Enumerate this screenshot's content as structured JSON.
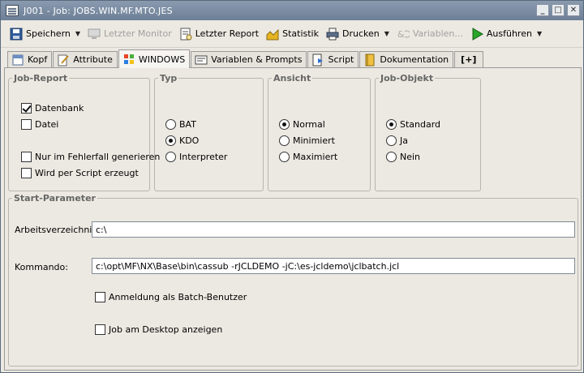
{
  "window": {
    "title": "J001 - Job: JOBS.WIN.MF.MTO.JES",
    "min_glyph": "_",
    "max_glyph": "□",
    "close_glyph": "✕"
  },
  "toolbar": {
    "save": "Speichern",
    "monitor": "Letzter Monitor",
    "report": "Letzter Report",
    "stats": "Statistik",
    "print": "Drucken",
    "variables": "Variablen...",
    "run": "Ausführen",
    "dropdown_glyph": "▼"
  },
  "tabs": [
    {
      "label": "Kopf",
      "icon": "head-icon"
    },
    {
      "label": "Attribute",
      "icon": "pen-icon"
    },
    {
      "label": "WINDOWS",
      "icon": "windows-icon"
    },
    {
      "label": "Variablen & Prompts",
      "icon": "vars-icon"
    },
    {
      "label": "Script",
      "icon": "script-icon"
    },
    {
      "label": "Dokumentation",
      "icon": "book-icon"
    },
    {
      "label": "[+]",
      "icon": "plus-icon"
    }
  ],
  "active_tab": "WINDOWS",
  "job_report": {
    "legend": "Job-Report",
    "database": {
      "label": "Datenbank",
      "checked": true
    },
    "file": {
      "label": "Datei",
      "checked": false
    },
    "only_error": {
      "label": "Nur im Fehlerfall generieren",
      "checked": false
    },
    "by_script": {
      "label": "Wird per Script erzeugt",
      "checked": false
    }
  },
  "type": {
    "legend": "Typ",
    "options": [
      "BAT",
      "KDO",
      "Interpreter"
    ],
    "selected": "KDO"
  },
  "view": {
    "legend": "Ansicht",
    "options": [
      "Normal",
      "Minimiert",
      "Maximiert"
    ],
    "selected": "Normal"
  },
  "job_object": {
    "legend": "Job-Objekt",
    "options": [
      "Standard",
      "Ja",
      "Nein"
    ],
    "selected": "Standard"
  },
  "start": {
    "legend": "Start-Parameter",
    "workdir_label": "Arbeitsverzeichnis:",
    "workdir_value": "c:\\",
    "command_label": "Kommando:",
    "command_value": "c:\\opt\\MF\\NX\\Base\\bin\\cassub -rJCLDEMO -jC:\\es-jcldemo\\jclbatch.jcl",
    "batch_user": {
      "label": "Anmeldung als Batch-Benutzer",
      "checked": false
    },
    "desktop": {
      "label": "Job am Desktop anzeigen",
      "checked": false
    }
  }
}
